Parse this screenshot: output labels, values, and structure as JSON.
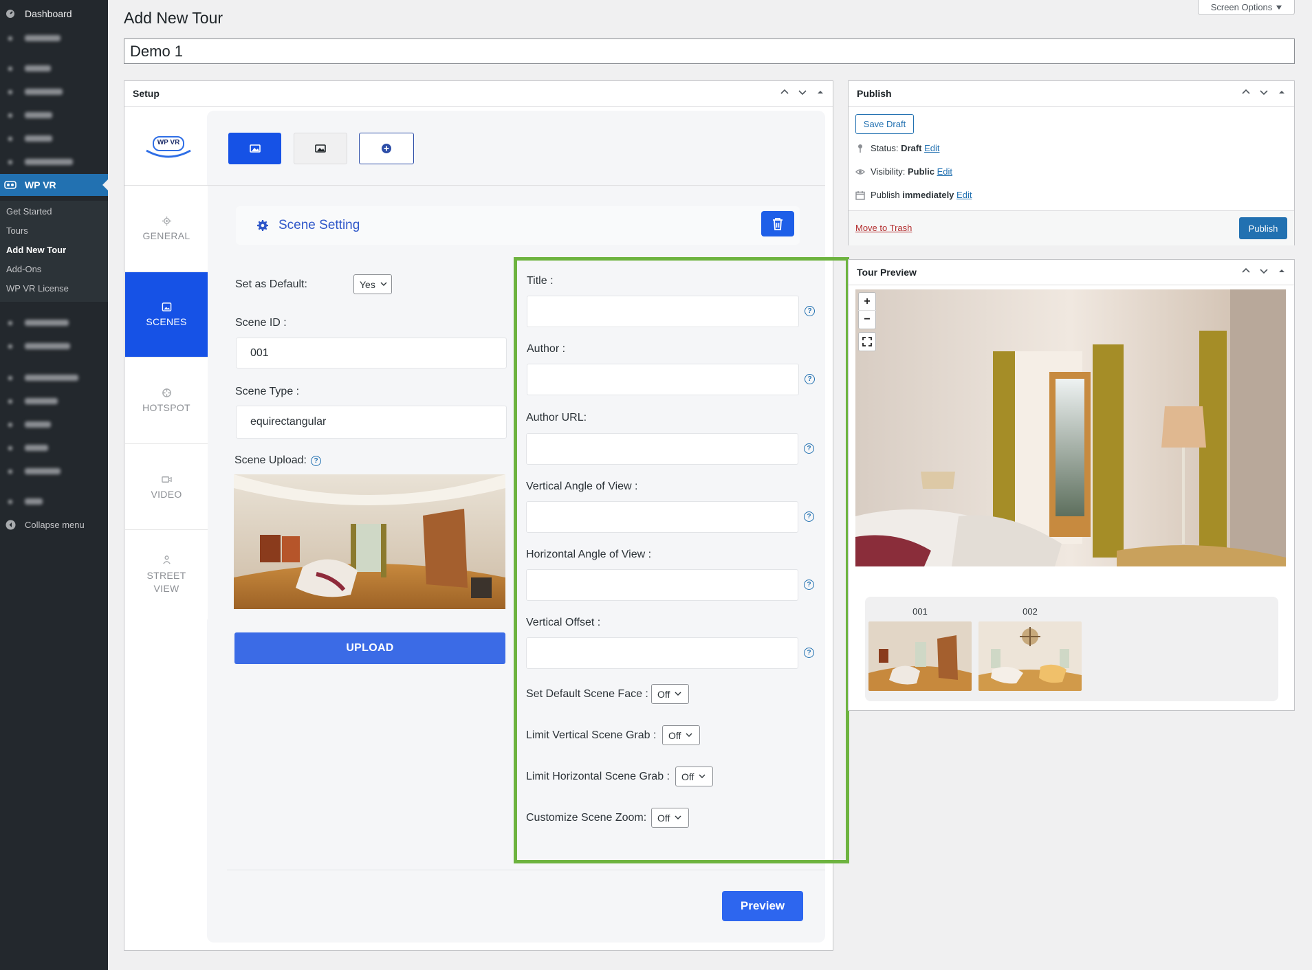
{
  "sidebar": {
    "dashboard": "Dashboard",
    "wpvr": "WP VR",
    "submenu": [
      "Get Started",
      "Tours",
      "Add New Tour",
      "Add-Ons",
      "WP VR License"
    ],
    "collapse": "Collapse menu"
  },
  "screen_options": "Screen Options",
  "page_title": "Add New Tour",
  "post_title": "Demo 1",
  "setup": {
    "title": "Setup",
    "logo_text": "WP VR",
    "tabs": [
      "GENERAL",
      "SCENES",
      "HOTSPOT",
      "VIDEO",
      "STREET VIEW"
    ],
    "scene_setting": "Scene Setting",
    "set_default_label": "Set as Default:",
    "set_default_value": "Yes",
    "scene_id_label": "Scene ID :",
    "scene_id_value": "001",
    "scene_type_label": "Scene Type :",
    "scene_type_value": "equirectangular",
    "scene_upload_label": "Scene Upload:",
    "upload_button": "UPLOAD",
    "fields": [
      "Title :",
      "Author :",
      "Author URL:",
      "Vertical Angle of View :",
      "Horizontal Angle of View :",
      "Vertical Offset :"
    ],
    "toggles": [
      {
        "label": "Set Default Scene Face :",
        "value": "Off"
      },
      {
        "label": "Limit Vertical Scene Grab :",
        "value": "Off"
      },
      {
        "label": "Limit Horizontal Scene Grab :",
        "value": "Off"
      },
      {
        "label": "Customize Scene Zoom:",
        "value": "Off"
      }
    ],
    "preview_button": "Preview"
  },
  "publish": {
    "title": "Publish",
    "save_draft": "Save Draft",
    "status_label": "Status:",
    "status_value": "Draft",
    "visibility_label": "Visibility:",
    "visibility_value": "Public",
    "publish_label": "Publish",
    "publish_value": "immediately",
    "edit": "Edit",
    "move_to_trash": "Move to Trash",
    "publish_button": "Publish"
  },
  "tour_preview": {
    "title": "Tour Preview",
    "zoom_in": "+",
    "zoom_out": "−",
    "scenes": [
      "001",
      "002"
    ]
  },
  "colors": {
    "wp_blue": "#2271b1",
    "plugin_blue": "#1652e6",
    "highlight_green": "#6db33f",
    "sidebar_dark": "#23282d"
  }
}
